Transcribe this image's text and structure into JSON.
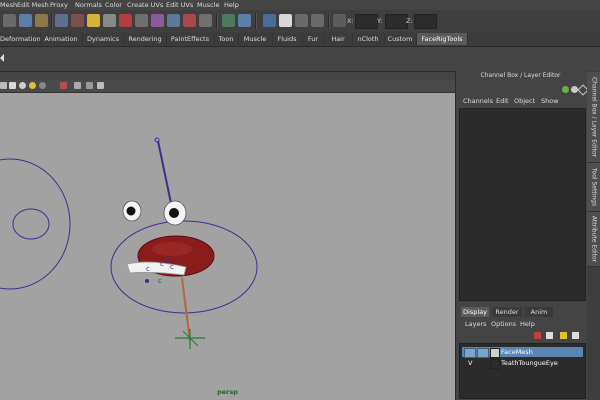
{
  "menubar": {
    "items": [
      "Mesh",
      "Edit Mesh",
      "Proxy",
      "Normals",
      "Color",
      "Create UVs",
      "Edit UVs",
      "Muscle",
      "Help"
    ]
  },
  "statusline": {
    "x_label": "X:",
    "y_label": "Y:",
    "z_label": "Z:",
    "x_value": "",
    "y_value": "",
    "z_value": ""
  },
  "shelf": {
    "tabs": [
      "Deformation",
      "Animation",
      "Dynamics",
      "Rendering",
      "PaintEffects",
      "Toon",
      "Muscle",
      "Fluids",
      "Fur",
      "Hair",
      "nCloth",
      "Custom",
      "FaceRigTools"
    ],
    "active_tab": "FaceRigTools"
  },
  "viewport": {
    "camera_label": "persp",
    "background_color": "#a2a2a2"
  },
  "channel_box": {
    "title": "Channel Box / Layer Editor",
    "menus": [
      "Channels",
      "Edit",
      "Object",
      "Show"
    ]
  },
  "side_tabs": [
    "Channel Box / Layer Editor",
    "Tool Settings",
    "Attribute Editor"
  ],
  "layer_editor": {
    "tabs": [
      "Display",
      "Render",
      "Anim"
    ],
    "active_tab": "Display",
    "menus": [
      "Layers",
      "Options",
      "Help"
    ],
    "layers": [
      {
        "name": "FaceMesh",
        "visible_flag": "",
        "selected": true
      },
      {
        "name": "TeathToungueEye",
        "visible_flag": "V",
        "selected": false
      }
    ]
  },
  "colors": {
    "accent": "#5a86b3",
    "mouth": "#8b1c1c",
    "curve": "#3b2f8f"
  }
}
